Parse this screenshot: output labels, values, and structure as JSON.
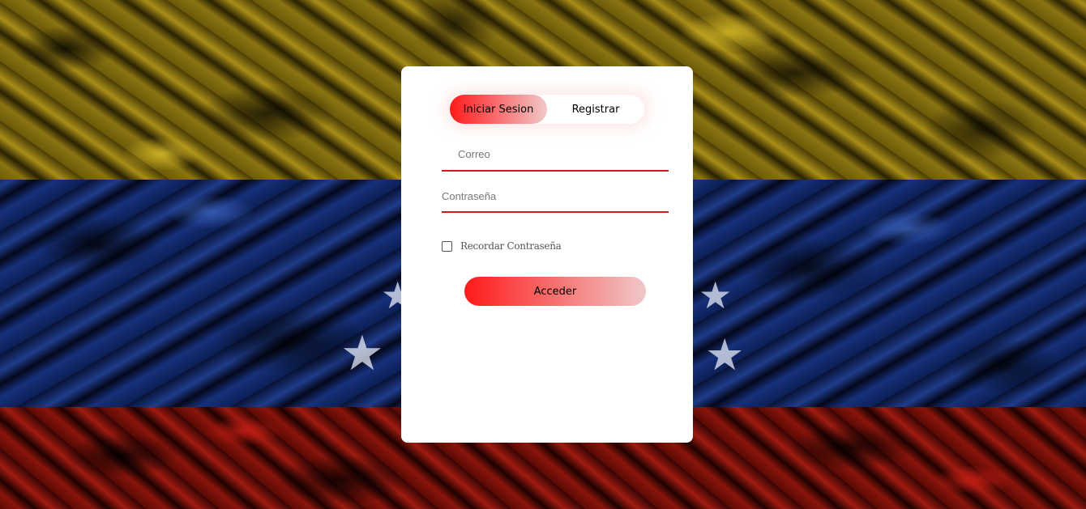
{
  "background": {
    "colors": {
      "yellow": "#8a7412",
      "blue": "#16307a",
      "red": "#8a150b"
    }
  },
  "login_card": {
    "tabs": [
      {
        "label": "Iniciar Sesion",
        "active": true
      },
      {
        "label": "Registrar",
        "active": false
      }
    ],
    "email_placeholder": "Correo",
    "password_placeholder": "Contraseña",
    "remember_label": "Recordar Contraseña",
    "remember_checked": false,
    "submit_label": "Acceder",
    "accent_color": "#d11a1a"
  }
}
